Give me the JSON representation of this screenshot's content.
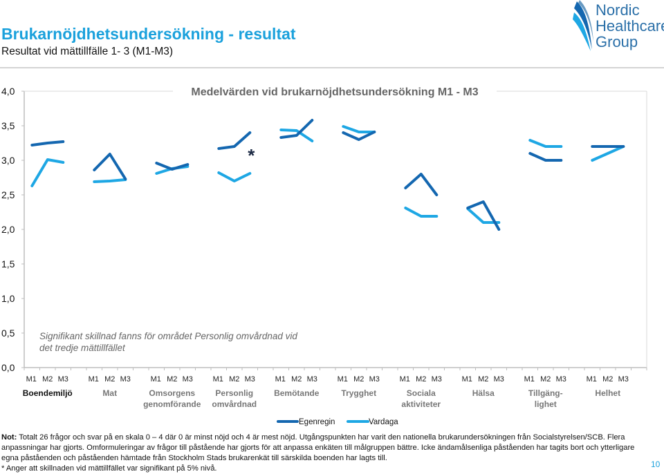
{
  "header": {
    "title": "Brukarnöjdhetsundersökning - resultat",
    "subtitle": "Resultat vid mättillfälle 1- 3 (M1-M3)",
    "logo_lines": [
      "Nordic",
      "Healthcare",
      "Group"
    ]
  },
  "colors": {
    "title": "#1ba1dc",
    "egenregin": "#1467b0",
    "vardaga": "#1ea7e4",
    "axis": "#bdbdbd"
  },
  "chart_data": {
    "type": "line",
    "title": "Medelvärden vid brukarnöjdhetsundersökning M1 - M3",
    "xlabel": "",
    "ylabel": "",
    "ylim": [
      0,
      4
    ],
    "yticks": [
      "0,0",
      "0,5",
      "1,0",
      "1,5",
      "2,0",
      "2,5",
      "3,0",
      "3,5",
      "4,0"
    ],
    "ytick_values": [
      0,
      0.5,
      1,
      1.5,
      2,
      2.5,
      3,
      3.5,
      4
    ],
    "grid": false,
    "legend_position": "bottom",
    "measurements": [
      "M1",
      "M2",
      "M3"
    ],
    "categories": [
      [
        "Boendemiljö"
      ],
      [
        "Mat"
      ],
      [
        "Omsorgens",
        "genomförande"
      ],
      [
        "Personlig",
        "omvårdnad"
      ],
      [
        "Bemötande"
      ],
      [
        "Trygghet"
      ],
      [
        "Sociala",
        "aktiviteter"
      ],
      [
        "Hälsa"
      ],
      [
        "Tillgäng-",
        "lighet"
      ],
      [
        "Helhet"
      ]
    ],
    "series": [
      {
        "name": "Egenregin",
        "values": [
          [
            3.22,
            3.25,
            3.27
          ],
          [
            2.86,
            3.09,
            2.73
          ],
          [
            2.96,
            2.87,
            2.94
          ],
          [
            3.17,
            3.2,
            3.4
          ],
          [
            3.33,
            3.36,
            3.58
          ],
          [
            3.4,
            3.3,
            3.41
          ],
          [
            2.6,
            2.8,
            2.5
          ],
          [
            2.31,
            2.4,
            2.0
          ],
          [
            3.1,
            3.0,
            3.0
          ],
          [
            3.2,
            3.2,
            3.2
          ]
        ]
      },
      {
        "name": "Vardaga",
        "values": [
          [
            2.63,
            3.01,
            2.97
          ],
          [
            2.69,
            2.7,
            2.72
          ],
          [
            2.81,
            2.88,
            2.91
          ],
          [
            2.82,
            2.7,
            2.81
          ],
          [
            3.44,
            3.43,
            3.28
          ],
          [
            3.49,
            3.41,
            3.41
          ],
          [
            2.31,
            2.19,
            2.19
          ],
          [
            2.3,
            2.1,
            2.1
          ],
          [
            3.29,
            3.2,
            3.2
          ],
          [
            3.0,
            3.1,
            3.2
          ]
        ]
      }
    ],
    "annotations": [
      {
        "text": "*",
        "category": "Personlig omvårdnad",
        "measurement": "M3"
      },
      {
        "text_lines": [
          "Signifikant skillnad fanns för området Personlig omvårdnad vid",
          "det tredje mättillfället"
        ]
      }
    ]
  },
  "notes": {
    "label": "Not:",
    "line1": " Totalt 26 frågor och svar på en skala 0 – 4 där 0 är minst nöjd och 4 är mest nöjd.  Utgångspunkten har varit den nationella brukarundersökningen från Socialstyrelsen/SCB.  Flera",
    "line2": "anpassningar har gjorts. Omformuleringar av frågor till påstående har gjorts för att anpassa enkäten till målgruppen bättre. Icke ändamålsenliga påståenden har tagits bort och ytterligare",
    "line3": "egna påståenden  och påståenden hämtade från Stockholm Stads brukarenkät till särskilda boenden har lagts till.",
    "line4": "* Anger att skillnaden vid mättillfället var signifikant på 5% nivå."
  },
  "page_number": "10"
}
